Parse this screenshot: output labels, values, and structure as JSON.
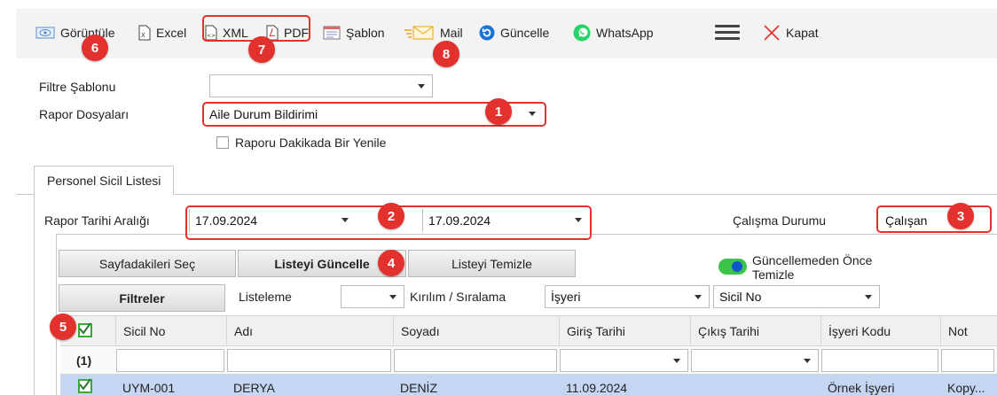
{
  "toolbar": {
    "view_label": "Görüntüle",
    "excel_label": "Excel",
    "xml_label": "XML",
    "pdf_label": "PDF",
    "template_label": "Şablon",
    "mail_label": "Mail",
    "refresh_label": "Güncelle",
    "whatsapp_label": "WhatsApp",
    "close_label": "Kapat"
  },
  "form": {
    "filter_template_label": "Filtre Şablonu",
    "filter_template_value": "",
    "report_files_label": "Rapor Dosyaları",
    "report_files_value": "Aile Durum Bildirimi",
    "refresh_every_minute_label": "Raporu Dakikada Bir Yenile"
  },
  "tab": {
    "label": "Personel Sicil Listesi"
  },
  "report": {
    "date_range_label": "Rapor Tarihi Aralığı",
    "start_date": "17.09.2024",
    "end_date": "17.09.2024",
    "work_status_label": "Çalışma Durumu",
    "work_status_value": "Çalışan"
  },
  "actions": {
    "select_page_label": "Sayfadakileri Seç",
    "update_list_label": "Listeyi Güncelle",
    "clear_list_label": "Listeyi Temizle",
    "clear_before_update_label_1": "Güncellemeden Önce",
    "clear_before_update_label_2": "Temizle",
    "filters_label": "Filtreler",
    "listing_label": "Listeleme",
    "listing_value": "",
    "breakdown_label": "Kırılım / Sıralama",
    "breakdown_value_1": "İşyeri",
    "breakdown_value_2": "Sicil No"
  },
  "grid": {
    "columns": [
      "Sicil No",
      "Adı",
      "Soyadı",
      "Giriş Tarihi",
      "Çıkış Tarihi",
      "İşyeri Kodu",
      "Not"
    ],
    "group_count": "(1)",
    "rows": [
      {
        "sicil_no": "UYM-001",
        "adi": "DERYA",
        "soyadi": "DENİZ",
        "giris": "11.09.2024",
        "cikis": "",
        "isyeri": "Örnek İşyeri",
        "not": "Kopy..."
      }
    ]
  },
  "annotations": [
    "1",
    "2",
    "3",
    "4",
    "5",
    "6",
    "7",
    "8"
  ],
  "colors": {
    "annotation_red": "#e3312d",
    "toggle_green": "#3cc34a",
    "selected_row": "#c5d6f2",
    "toolbar_bg": "#f3f3f3"
  }
}
